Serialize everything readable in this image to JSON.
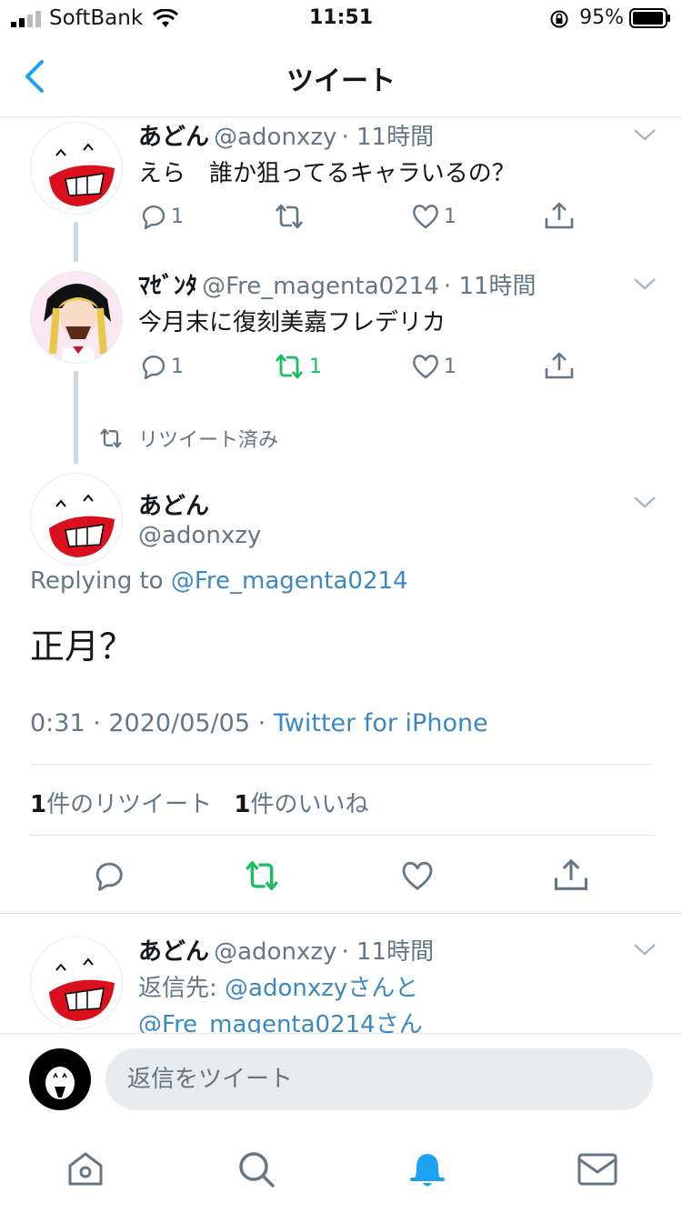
{
  "status": {
    "carrier": "SoftBank",
    "time": "11:51",
    "battery": "95%"
  },
  "header": {
    "title": "ツイート"
  },
  "tweet1": {
    "name": "あどん",
    "handle": "@adonxzy",
    "time": "· 11時間",
    "text": "えら　誰か狙ってるキャラいるの？",
    "replies": "1",
    "retweets": "",
    "likes": "1"
  },
  "tweet2": {
    "name": "ﾏｾﾞﾝﾀ",
    "handle": "@Fre_magenta0214",
    "time": "· 11時間",
    "text": "今月末に復刻美嘉フレデリカ",
    "replies": "1",
    "retweets": "1",
    "likes": "1",
    "retweeted_label": "リツイート済み"
  },
  "main": {
    "name": "あどん",
    "handle": "@adonxzy",
    "replying_prefix": "Replying to",
    "replying_to": "@Fre_magenta0214",
    "text": "正月？",
    "timestamp": "0:31 · 2020/05/05 ·",
    "source": "Twitter for iPhone",
    "retweet_count": "1",
    "retweet_label": "件のリツイート",
    "like_count": "1",
    "like_label": "件のいいね"
  },
  "reply": {
    "name": "あどん",
    "handle": "@adonxzy",
    "time": "· 11時間",
    "prefix": "返信先:",
    "to1": "@adonxzy",
    "suffix1": "さんと",
    "to2": "@Fre_magenta0214",
    "suffix2": "さん"
  },
  "composer": {
    "placeholder": "返信をツイート"
  },
  "colors": {
    "link": "#3b88c3",
    "retweet_green": "#17bf63",
    "tab_active": "#1da1f2"
  }
}
